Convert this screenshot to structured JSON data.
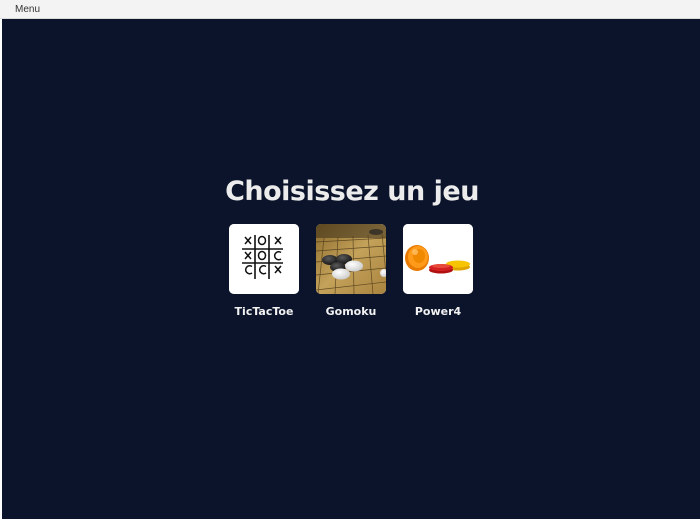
{
  "menubar": {
    "menu_label": "Menu"
  },
  "heading": {
    "title": "Choisissez un jeu"
  },
  "games": [
    {
      "label": "TicTacToe",
      "icon": "tictactoe-icon"
    },
    {
      "label": "Gomoku",
      "icon": "gomoku-board-icon"
    },
    {
      "label": "Power4",
      "icon": "power4-tokens-icon"
    }
  ],
  "colors": {
    "background": "#0b142b",
    "menubar": "#f3f3f3",
    "title_text": "#ececec"
  }
}
